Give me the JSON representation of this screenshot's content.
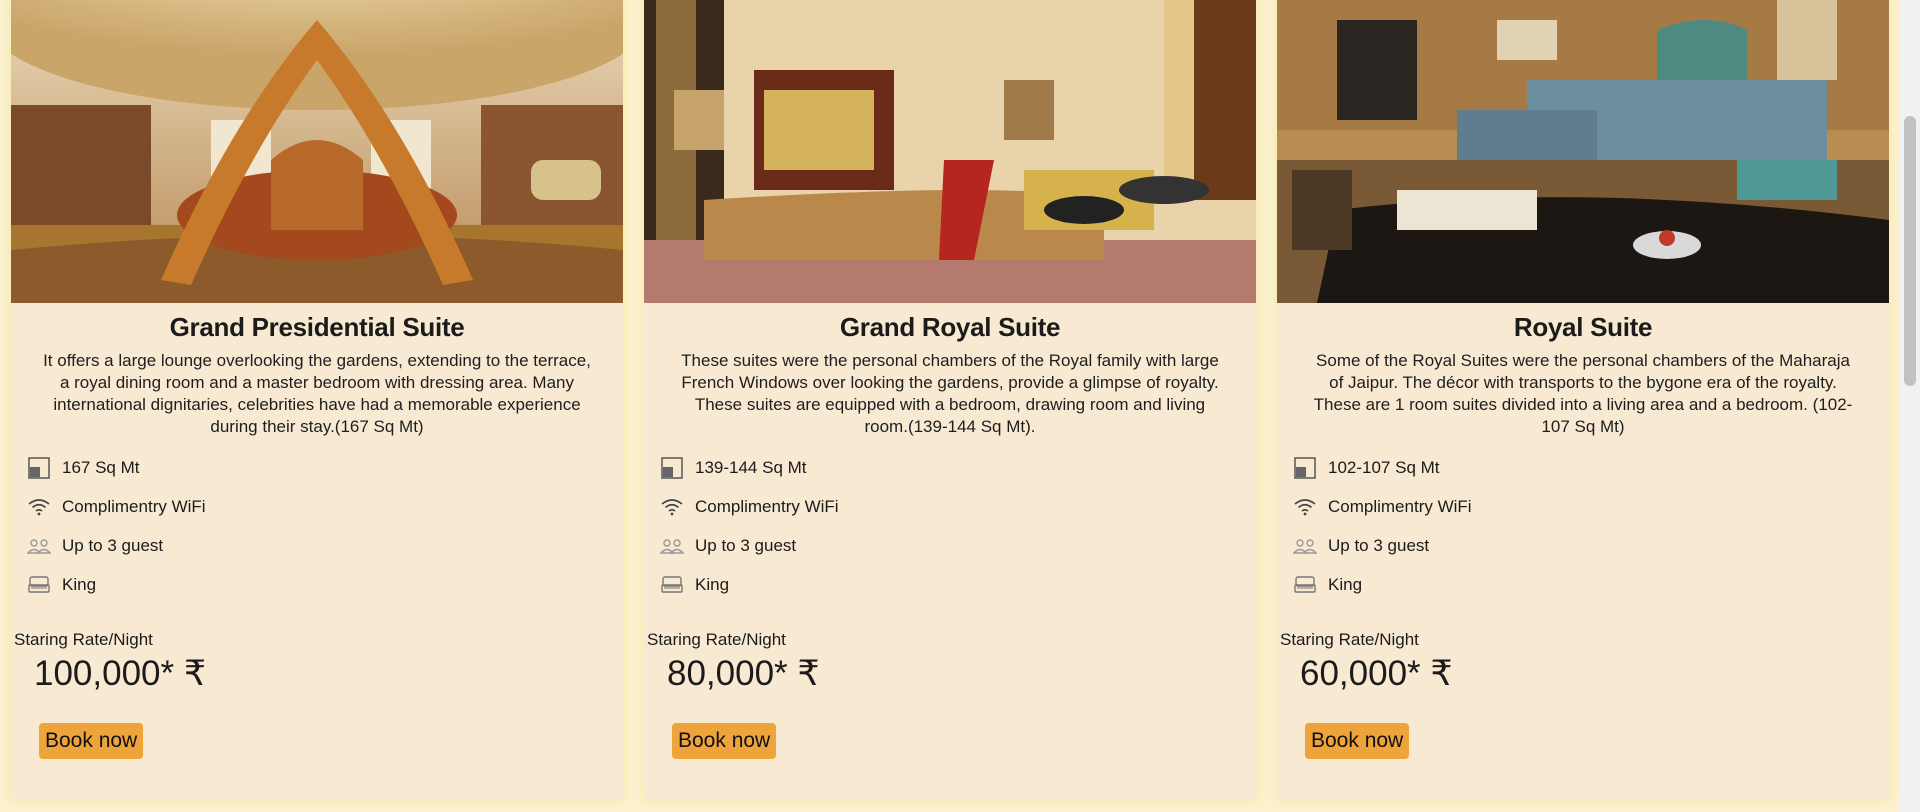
{
  "suites": [
    {
      "title": "Grand Presidential Suite",
      "description": "It offers a large lounge overlooking the gardens, extending to the terrace, a royal dining room and a master bedroom with dressing area. Many international dignitaries, celebrities have had a memorable experience during their stay.(167 Sq Mt)",
      "area": "167 Sq Mt",
      "wifi": "Complimentry WiFi",
      "guests": "Up to 3 guest",
      "bed": "King",
      "rate_label": "Staring Rate/Night",
      "price": "100,000* ₹",
      "book_label": "Book now"
    },
    {
      "title": "Grand Royal Suite",
      "description": "These suites were the personal chambers of the Royal family with large French Windows over looking the gardens, provide a glimpse of royalty. These suites are equipped with a bedroom, drawing room and living room.(139-144 Sq Mt).",
      "area": "139-144 Sq Mt",
      "wifi": "Complimentry WiFi",
      "guests": "Up to 3 guest",
      "bed": "King",
      "rate_label": "Staring Rate/Night",
      "price": "80,000* ₹",
      "book_label": "Book now"
    },
    {
      "title": "Royal Suite",
      "description": "Some of the Royal Suites were the personal chambers of the Maharaja of Jaipur. The décor with transports to the bygone era of the royalty. These are 1 room suites divided into a living area and a bedroom. (102-107 Sq Mt)",
      "area": "102-107 Sq Mt",
      "wifi": "Complimentry WiFi",
      "guests": "Up to 3 guest",
      "bed": "King",
      "rate_label": "Staring Rate/Night",
      "price": "60,000* ₹",
      "book_label": "Book now"
    }
  ],
  "colors": {
    "page_bg": "#fbf1cf",
    "card_bg": "#f8e9d2",
    "button_bg": "#efa33b"
  },
  "icons": [
    "area-icon",
    "wifi-icon",
    "guests-icon",
    "bed-icon"
  ]
}
